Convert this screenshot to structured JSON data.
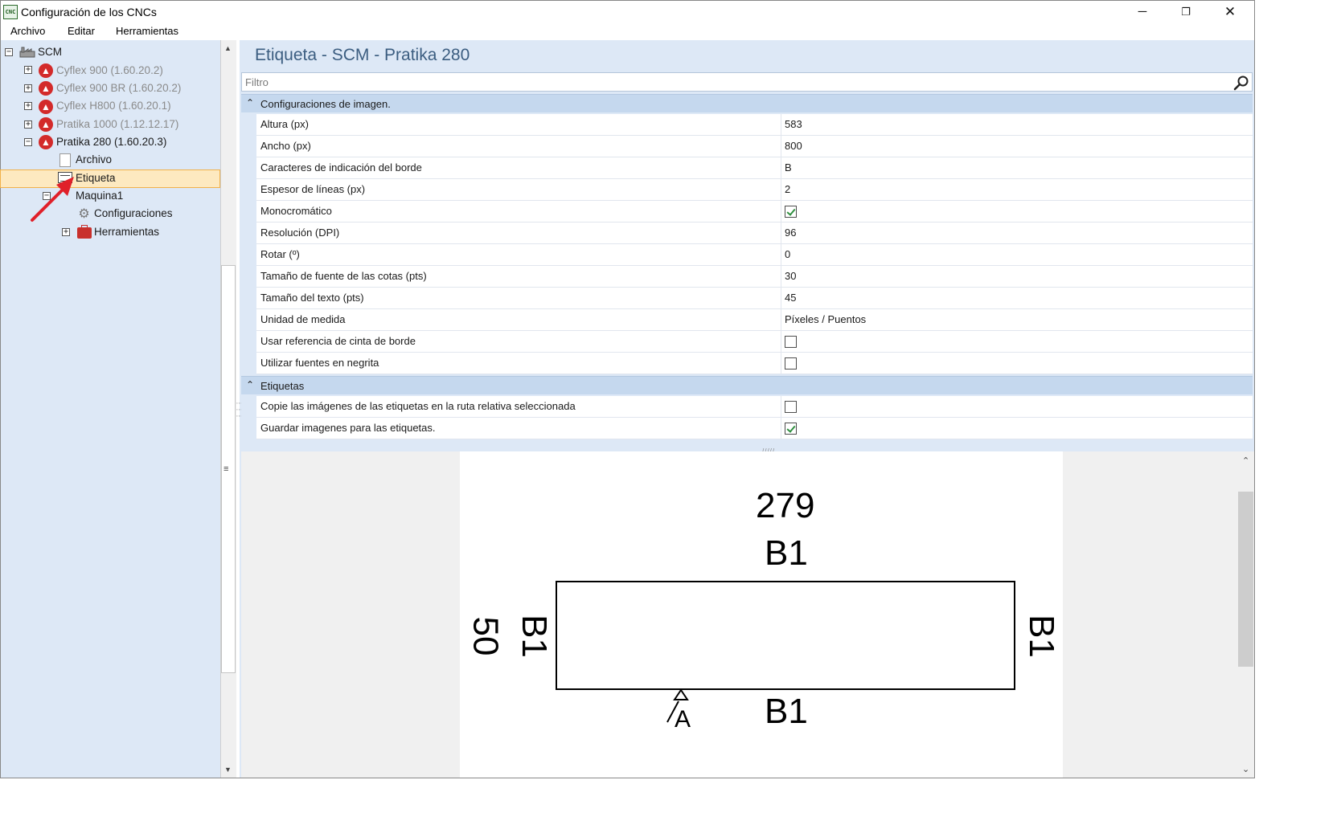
{
  "window": {
    "title": "Configuración de los CNCs",
    "app_icon_text": "CNC",
    "minimize": "─",
    "maximize": "❐",
    "close": "✕"
  },
  "menu": {
    "items": [
      "Archivo",
      "Editar",
      "Herramientas"
    ]
  },
  "tree": {
    "root": "SCM",
    "machines": [
      {
        "label": "Cyflex 900 (1.60.20.2)",
        "enabled": false
      },
      {
        "label": "Cyflex 900 BR (1.60.20.2)",
        "enabled": false
      },
      {
        "label": "Cyflex H800 (1.60.20.1)",
        "enabled": false
      },
      {
        "label": "Pratika 1000 (1.12.12.17)",
        "enabled": false
      },
      {
        "label": "Pratika 280 (1.60.20.3)",
        "enabled": true
      }
    ],
    "children": {
      "archivo": "Archivo",
      "etiqueta": "Etiqueta",
      "maquina": "Maquina1",
      "configuraciones": "Configuraciones",
      "herramientas": "Herramientas"
    },
    "expand_plus": "+",
    "expand_minus": "−",
    "selected": "Etiqueta"
  },
  "panel": {
    "title": "Etiqueta - SCM - Pratika 280",
    "filter_placeholder": "Filtro"
  },
  "categories": [
    {
      "label": "Configuraciones de imagen.",
      "properties": [
        {
          "name": "Altura (px)",
          "value": "583"
        },
        {
          "name": "Ancho (px)",
          "value": "800"
        },
        {
          "name": "Caracteres de indicación del borde",
          "value": "B"
        },
        {
          "name": "Espesor de líneas (px)",
          "value": "2"
        },
        {
          "name": "Monocromático",
          "checked": true
        },
        {
          "name": "Resolución (DPI)",
          "value": "96"
        },
        {
          "name": "Rotar (º)",
          "value": "0"
        },
        {
          "name": "Tamaño de fuente de las cotas (pts)",
          "value": "30"
        },
        {
          "name": "Tamaño del texto (pts)",
          "value": "45"
        },
        {
          "name": "Unidad de medida",
          "value": "Píxeles / Puentos"
        },
        {
          "name": "Usar referencia de cinta de borde",
          "checked": false
        },
        {
          "name": "Utilizar fuentes en negrita",
          "checked": false
        }
      ]
    },
    {
      "label": "Etiquetas",
      "properties": [
        {
          "name": "Copie las imágenes de las etiquetas en la ruta relativa seleccionada",
          "checked": false
        },
        {
          "name": "Guardar imagenes para las etiquetas.",
          "checked": true
        }
      ]
    }
  ],
  "preview": {
    "length": "279",
    "width": "50",
    "edge_top": "B1",
    "edge_bottom": "B1",
    "edge_left": "B1",
    "edge_right": "B1",
    "grain_mark": "A"
  },
  "colors": {
    "panel_bg": "#dde8f6",
    "category_bg": "#c5d8ee",
    "selection_bg": "#fde9c0",
    "selection_border": "#f1b14a",
    "title_color": "#3b5d80",
    "cnc_icon": "#d32a2a",
    "arrow": "#e0202a"
  }
}
